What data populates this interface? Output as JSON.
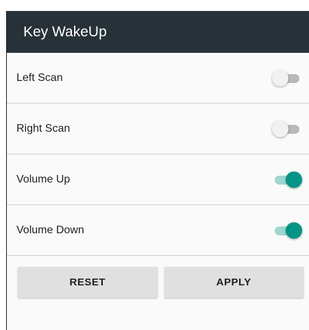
{
  "app_bar": {
    "title": "Key WakeUp"
  },
  "settings": [
    {
      "label": "Left Scan",
      "enabled": false
    },
    {
      "label": "Right Scan",
      "enabled": false
    },
    {
      "label": "Volume Up",
      "enabled": true
    },
    {
      "label": "Volume Down",
      "enabled": true
    }
  ],
  "buttons": {
    "reset_label": "RESET",
    "apply_label": "APPLY"
  },
  "colors": {
    "app_bar": "#263238",
    "accent": "#009587",
    "accent_track": "#9fd6cd",
    "switch_off_track": "#b9b9b9",
    "switch_off_thumb": "#f1f1f1",
    "button_bg": "#e0e0e0"
  }
}
